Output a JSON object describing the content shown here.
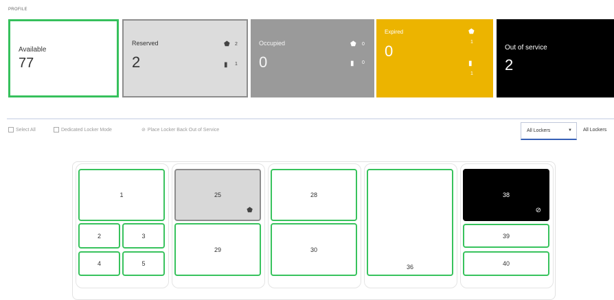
{
  "section_label": "PROFILE",
  "cards": {
    "available": {
      "title": "Available",
      "count": "77"
    },
    "reserved": {
      "title": "Reserved",
      "count": "2",
      "icon_a": "shield-icon",
      "num_a": "2",
      "icon_b": "box-icon",
      "num_b": "1"
    },
    "occupied": {
      "title": "Occupied",
      "count": "0",
      "icon_a": "shield-icon",
      "num_a": "0",
      "icon_b": "box-icon",
      "num_b": "0"
    },
    "expired": {
      "title": "Expired",
      "count": "0",
      "icon_a": "shield-icon",
      "num_a": "1",
      "icon_b": "box-icon",
      "num_b": "1"
    },
    "out_of_service": {
      "title": "Out of service",
      "count": "2"
    }
  },
  "toolbar": {
    "select_all": "Select All",
    "dedicated_mode": "Dedicated Locker Mode",
    "place_back": "Place Locker Back Out of Service",
    "filter_value": "All Lockers",
    "filter_label": "All Lockers"
  },
  "lockers": {
    "l1": "1",
    "l2": "2",
    "l3": "3",
    "l4": "4",
    "l5": "5",
    "l25": "25",
    "l29": "29",
    "l28": "28",
    "l30": "30",
    "l36": "36",
    "l38": "38",
    "l39": "39",
    "l40": "40"
  },
  "colors": {
    "available": "#36c05c",
    "reserved": "#dcdcdc",
    "occupied": "#9a9a9a",
    "expired": "#ecb400",
    "out_of_service": "#000000",
    "accent": "#355fb5"
  }
}
